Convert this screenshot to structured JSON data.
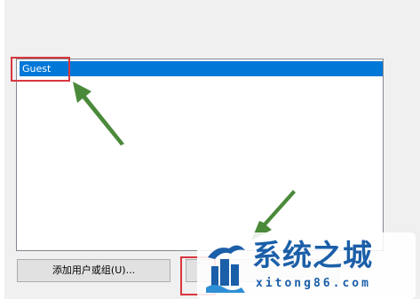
{
  "listbox": {
    "items": [
      {
        "label": "Guest",
        "selected": true
      }
    ]
  },
  "buttons": {
    "add_label": "添加用户或组(U)...",
    "remove_label": ""
  },
  "colors": {
    "selection": "#0078d7",
    "highlight_box": "#d9363e",
    "arrow": "#4a8a3a",
    "watermark": "#1b5fa8"
  },
  "watermark": {
    "title": "系统之城",
    "url": "xitong86.com"
  }
}
